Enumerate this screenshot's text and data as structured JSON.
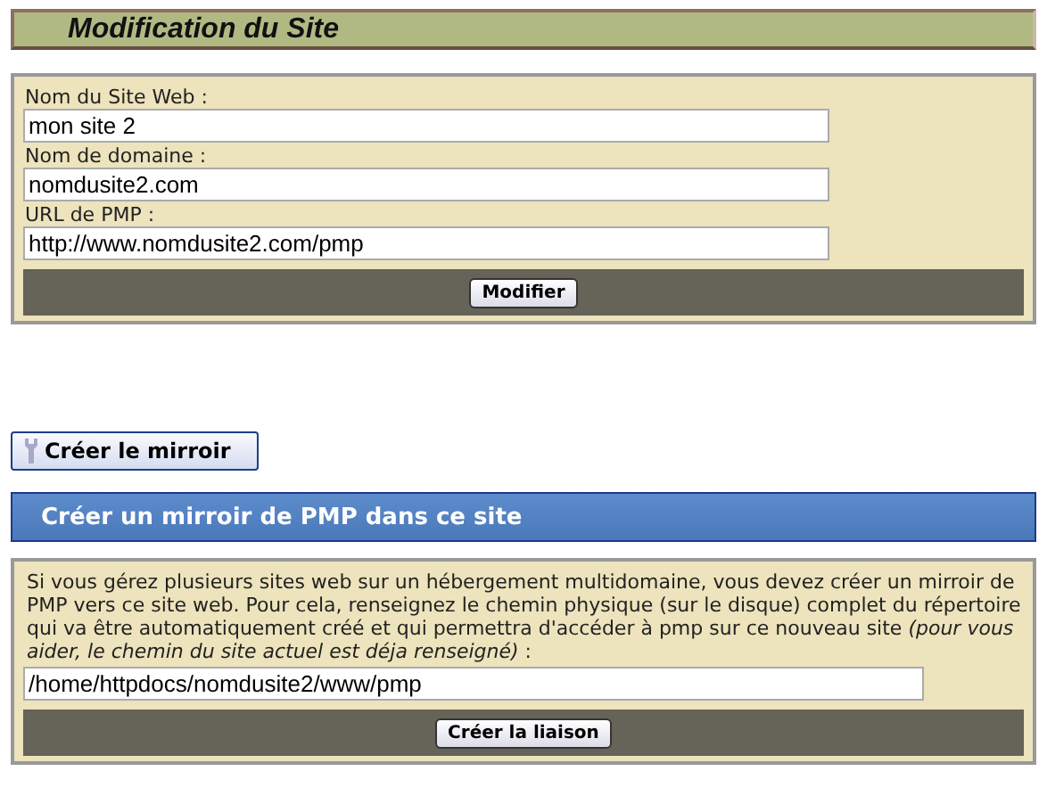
{
  "header": {
    "title": "Modification du Site"
  },
  "site_form": {
    "fields": [
      {
        "label": "Nom du Site Web :",
        "value": "mon site 2"
      },
      {
        "label": "Nom de domaine :",
        "value": "nomdusite2.com"
      },
      {
        "label": "URL de PMP :",
        "value": "http://www.nomdusite2.com/pmp"
      }
    ],
    "submit": "Modifier"
  },
  "mirror_button": "Créer le mirroir",
  "mirror_section": {
    "title": "Créer un mirroir de PMP dans ce site",
    "description": "Si vous gérez plusieurs sites web sur un hébergement multidomaine, vous devez créer un mirroir de PMP vers ce site web. Pour cela, renseignez le chemin physique (sur le disque) complet du répertoire qui va être automatiquement créé et qui permettra d'accéder à pmp sur ce nouveau site *(pour vous aider, le chemin du site actuel est déja renseigné)* :",
    "path_value": "/home/httpdocs/nomdusite2/www/pmp",
    "submit": "Créer la liaison"
  }
}
